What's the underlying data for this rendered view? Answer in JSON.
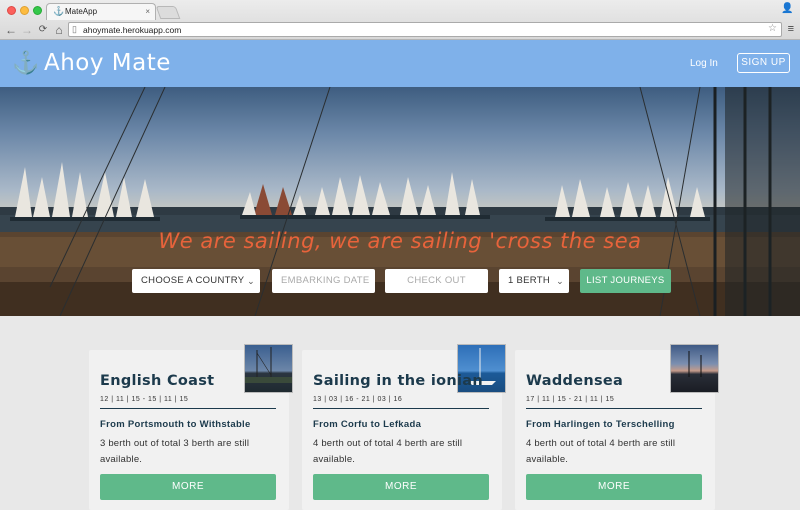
{
  "browser": {
    "tab_title": "MateApp",
    "tab_close": "×",
    "url": "ahoymate.herokuapp.com",
    "nav_back": "←",
    "nav_forward": "→",
    "nav_reload": "C",
    "nav_home": "⌂"
  },
  "header": {
    "brand": "Ahoy Mate",
    "login_label": "Log In",
    "signup_label": "SIGN UP"
  },
  "hero": {
    "tagline": "We are sailing, we are sailing 'cross the sea",
    "country_select": "CHOOSE A COUNTRY",
    "embarking_placeholder": "EMBARKING DATE",
    "checkout_placeholder": "CHECK OUT",
    "berth_select": "1 BERTH",
    "list_button": "LIST JOURNEYS"
  },
  "cards": [
    {
      "title": "English Coast",
      "dates": "12 | 11 | 15 - 15 | 11 | 15",
      "route": "From Portsmouth to Withstable",
      "availability": "3 berth out of total 3 berth are still available.",
      "more_label": "MORE"
    },
    {
      "title": "Sailing in the ionian",
      "dates": "13 | 03 | 16 - 21 | 03 | 16",
      "route": "From Corfu to Lefkada",
      "availability": "4 berth out of total 4 berth are still available.",
      "more_label": "MORE"
    },
    {
      "title": "Waddensea",
      "dates": "17 | 11 | 15 - 21 | 11 | 15",
      "route": "From Harlingen to Terschelling",
      "availability": "4 berth out of total 4 berth are still available.",
      "more_label": "MORE"
    }
  ],
  "colors": {
    "header_bg": "#7fb1ea",
    "accent_green": "#5fb98a",
    "tagline_orange": "#e8633b",
    "navy_text": "#1c3a4c"
  }
}
